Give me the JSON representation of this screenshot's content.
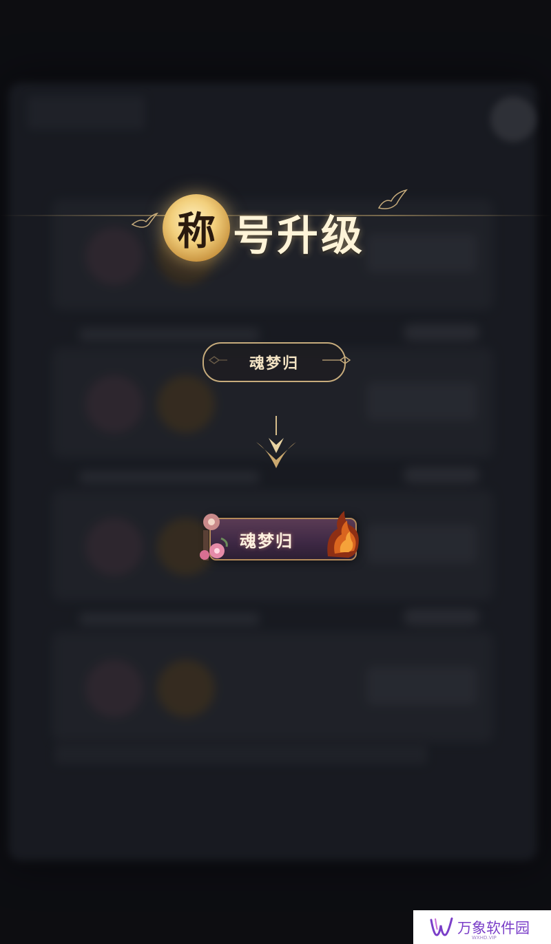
{
  "popup": {
    "title_first_char": "称",
    "title_rest": "号升级",
    "old_title": "魂梦归",
    "new_title": "魂梦归"
  },
  "watermark": {
    "text": "万象软件园",
    "sub": "WXHD.VIP"
  },
  "colors": {
    "gold": "#c7ac7c",
    "moon": "#f2cf7c",
    "badge_purple": "#3d2844",
    "watermark_purple": "#7a3ec8"
  },
  "icons": [
    "moon-icon",
    "swallow-icon",
    "down-arrow-icon",
    "flower-icon",
    "flame-icon",
    "close-icon"
  ]
}
